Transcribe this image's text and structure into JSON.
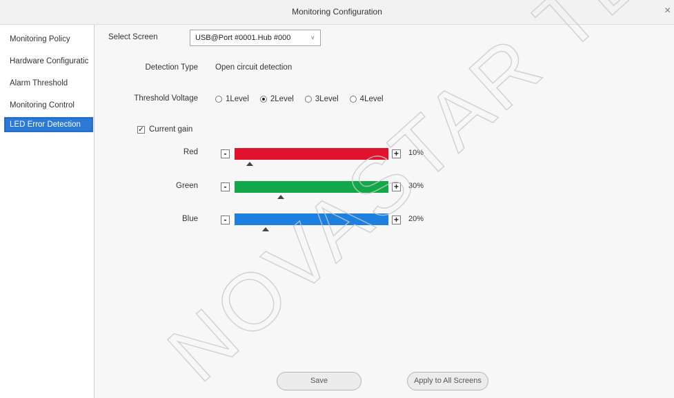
{
  "window": {
    "title": "Monitoring Configuration",
    "close_glyph": "×"
  },
  "sidebar": {
    "items": [
      {
        "label": "Monitoring Policy"
      },
      {
        "label": "Hardware Configuratic"
      },
      {
        "label": "Alarm Threshold"
      },
      {
        "label": "Monitoring Control"
      },
      {
        "label": "LED Error Detection"
      }
    ],
    "active_index": 4
  },
  "form": {
    "select_screen": {
      "label": "Select Screen",
      "value": "USB@Port #0001.Hub #000",
      "caret": "˅"
    },
    "detection_type": {
      "label": "Detection Type",
      "value": "Open circuit detection"
    },
    "threshold_voltage": {
      "label": "Threshold Voltage",
      "options": [
        "1Level",
        "2Level",
        "3Level",
        "4Level"
      ],
      "selected": "2Level"
    },
    "current_gain": {
      "label": "Current gain",
      "checked": true,
      "check_glyph": "✓",
      "minus_glyph": "-",
      "plus_glyph": "+",
      "channels": [
        {
          "label": "Red",
          "value_text": "10%",
          "value": 0.1,
          "color": "#e0122d"
        },
        {
          "label": "Green",
          "value_text": "30%",
          "value": 0.3,
          "color": "#12a84a"
        },
        {
          "label": "Blue",
          "value_text": "20%",
          "value": 0.2,
          "color": "#1d7fe0"
        }
      ]
    }
  },
  "buttons": {
    "save": "Save",
    "apply_all": "Apply to All Screens"
  },
  "watermark": {
    "text": "NOVASTAR TECH CO"
  }
}
